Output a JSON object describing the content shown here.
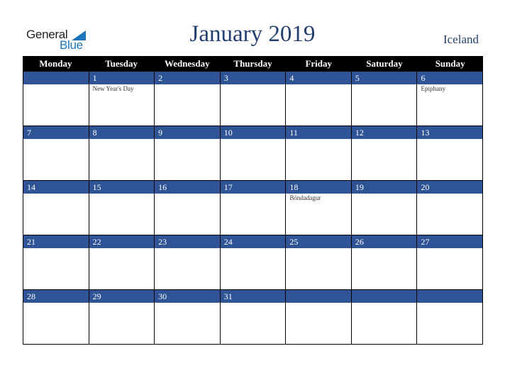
{
  "logo": {
    "general": "General",
    "blue": "Blue"
  },
  "title": "January 2019",
  "country": "Iceland",
  "weekdays": [
    "Monday",
    "Tuesday",
    "Wednesday",
    "Thursday",
    "Friday",
    "Saturday",
    "Sunday"
  ],
  "weeks": [
    [
      {
        "day": "",
        "event": ""
      },
      {
        "day": "1",
        "event": "New Year's Day"
      },
      {
        "day": "2",
        "event": ""
      },
      {
        "day": "3",
        "event": ""
      },
      {
        "day": "4",
        "event": ""
      },
      {
        "day": "5",
        "event": ""
      },
      {
        "day": "6",
        "event": "Epiphany"
      }
    ],
    [
      {
        "day": "7",
        "event": ""
      },
      {
        "day": "8",
        "event": ""
      },
      {
        "day": "9",
        "event": ""
      },
      {
        "day": "10",
        "event": ""
      },
      {
        "day": "11",
        "event": ""
      },
      {
        "day": "12",
        "event": ""
      },
      {
        "day": "13",
        "event": ""
      }
    ],
    [
      {
        "day": "14",
        "event": ""
      },
      {
        "day": "15",
        "event": ""
      },
      {
        "day": "16",
        "event": ""
      },
      {
        "day": "17",
        "event": ""
      },
      {
        "day": "18",
        "event": "Bóndadagur"
      },
      {
        "day": "19",
        "event": ""
      },
      {
        "day": "20",
        "event": ""
      }
    ],
    [
      {
        "day": "21",
        "event": ""
      },
      {
        "day": "22",
        "event": ""
      },
      {
        "day": "23",
        "event": ""
      },
      {
        "day": "24",
        "event": ""
      },
      {
        "day": "25",
        "event": ""
      },
      {
        "day": "26",
        "event": ""
      },
      {
        "day": "27",
        "event": ""
      }
    ],
    [
      {
        "day": "28",
        "event": ""
      },
      {
        "day": "29",
        "event": ""
      },
      {
        "day": "30",
        "event": ""
      },
      {
        "day": "31",
        "event": ""
      },
      {
        "day": "",
        "event": ""
      },
      {
        "day": "",
        "event": ""
      },
      {
        "day": "",
        "event": ""
      }
    ]
  ],
  "colors": {
    "header_bg": "#000000",
    "day_bar": "#2e5496",
    "title": "#243f6e",
    "logo_blue": "#1c75bc"
  }
}
